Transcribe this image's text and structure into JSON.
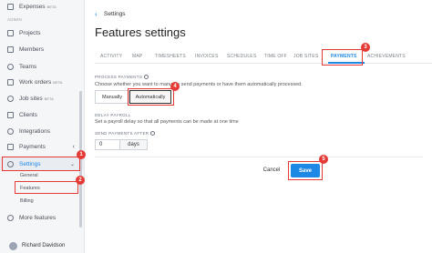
{
  "sidebar": {
    "top_item": {
      "label": "Expenses",
      "badge": "BETA"
    },
    "section_label": "ADMIN",
    "items": [
      {
        "label": "Projects",
        "icon": "folder-icon"
      },
      {
        "label": "Members",
        "icon": "members-icon"
      },
      {
        "label": "Teams",
        "icon": "teams-icon"
      },
      {
        "label": "Work orders",
        "badge": "BETA",
        "icon": "work-orders-icon"
      },
      {
        "label": "Job sites",
        "badge": "BETA",
        "icon": "location-pin-icon"
      },
      {
        "label": "Clients",
        "icon": "clients-icon"
      },
      {
        "label": "Integrations",
        "icon": "integrations-icon"
      },
      {
        "label": "Payments",
        "icon": "payments-icon"
      },
      {
        "label": "Settings",
        "icon": "gear-icon"
      }
    ],
    "settings_sub": [
      "General",
      "Features",
      "Billing"
    ],
    "more": "More features",
    "user": "Richard Davidson"
  },
  "header": {
    "breadcrumb": "Settings",
    "title": "Features settings"
  },
  "tabs": [
    "ACTIVITY",
    "MAP",
    "TIMESHEETS",
    "INVOICES",
    "SCHEDULES",
    "TIME OFF",
    "JOB SITES",
    "PAYMENTS",
    "ACHIEVEMENTS"
  ],
  "active_tab": "PAYMENTS",
  "process_payments": {
    "label": "PROCESS PAYMENTS",
    "description": "Choose whether you want to manually send payments or have them automatically processed.",
    "options": [
      "Manually",
      "Automatically"
    ],
    "selected": "Automatically"
  },
  "delay_payroll": {
    "label": "DELAY PAYROLL",
    "description": "Set a payroll delay so that all payments can be made at one time"
  },
  "send_after": {
    "label": "SEND PAYMENTS AFTER",
    "value": "0",
    "unit": "days"
  },
  "actions": {
    "cancel": "Cancel",
    "save": "Save"
  },
  "annotations": [
    "1",
    "2",
    "3",
    "4",
    "5"
  ],
  "colors": {
    "accent": "#1e88e5",
    "highlight": "#e53935"
  }
}
